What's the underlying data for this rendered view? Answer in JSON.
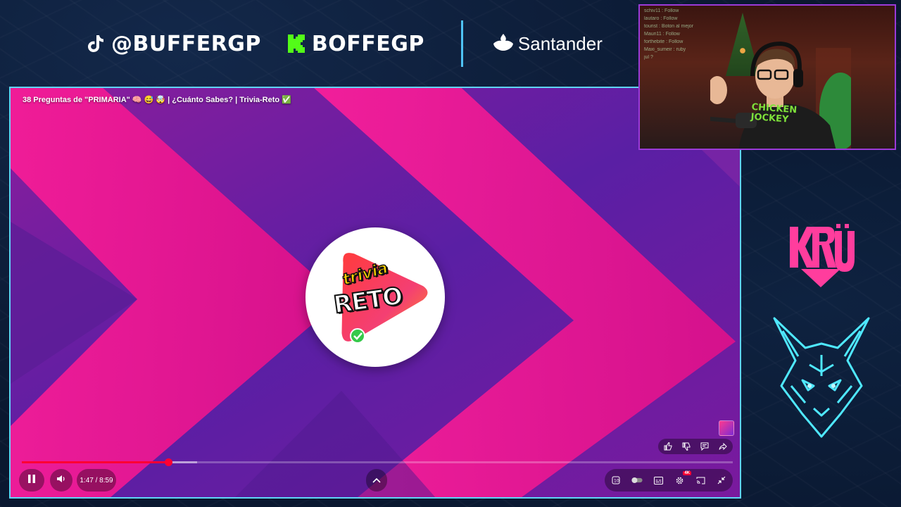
{
  "overlay": {
    "socials": [
      {
        "platform": "tiktok",
        "icon": "tiktok-icon",
        "handle": "@BUFFERGP"
      },
      {
        "platform": "kick",
        "icon": "kick-icon",
        "handle": "BOFFEGP"
      }
    ],
    "sponsor": {
      "icon": "santander-flame-icon",
      "name": "Santander"
    },
    "team_logo_icon": "kru-logo",
    "team_mascot_icon": "fox-head-icon"
  },
  "player": {
    "video_title": "38 Preguntas de \"PRIMARIA\" 🧠 😅 🤯 | ¿Cuánto Sabes? | Trivia-Reto ✅",
    "logo": {
      "word_top": "trivia",
      "word_main": "RETO"
    },
    "progress": {
      "played_fraction": 0.206,
      "buffered_fraction": 0.247
    },
    "time_display": "1:47 / 8:59",
    "quality_badge": "4K",
    "controls": {
      "play_pause_icon": "pause-icon",
      "volume_icon": "volume-icon",
      "expand_icon": "chevron-up-icon",
      "right": [
        "speed-icon",
        "autoplay-toggle-icon",
        "subtitles-icon",
        "settings-icon",
        "cast-icon",
        "exit-fullscreen-icon"
      ]
    },
    "actions": [
      "thumbs-up-icon",
      "thumbs-down-icon",
      "comment-icon",
      "share-icon"
    ]
  },
  "webcam": {
    "chat_lines": [
      "schiv11 : Follow",
      "lautaro : Follow",
      "tourist : Boton al mejor",
      "Mauri11 : Follow",
      "forthebite : Follow",
      "Maxi_sumeir : ruby",
      "jul ?"
    ],
    "shirt_text": [
      "CHICKEN",
      "JOCKEY"
    ]
  },
  "colors": {
    "accent_border": "#5fd4f5",
    "webcam_border": "#9b3ad8",
    "kick_green": "#53fc18",
    "progress_red": "#ff0033",
    "pink": "#ff1f9a",
    "purple": "#6a1fa0"
  }
}
